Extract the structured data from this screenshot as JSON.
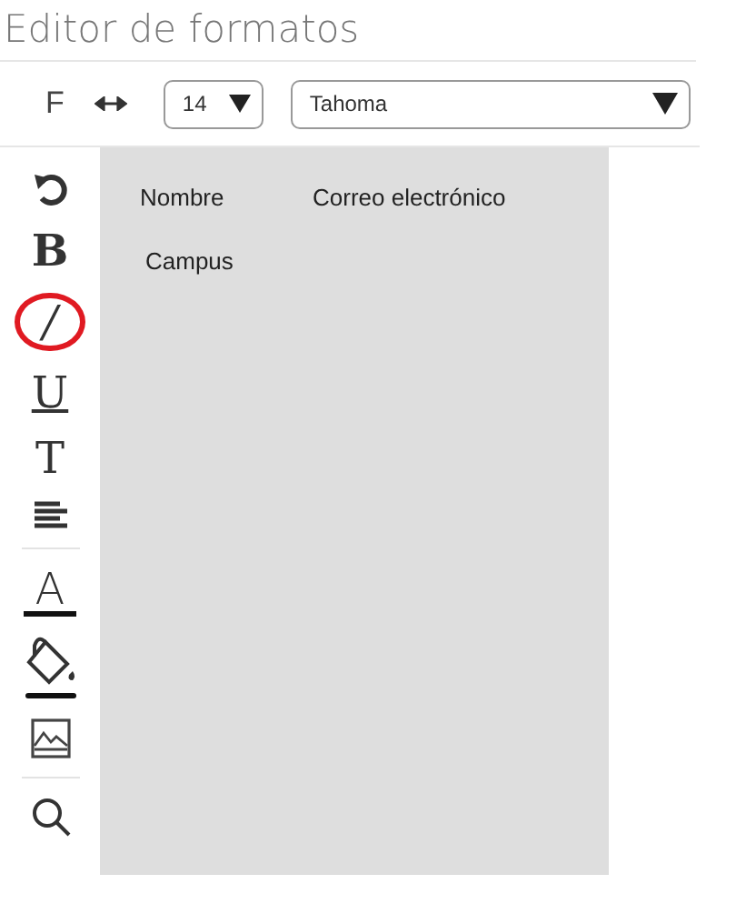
{
  "title": "Editor de formatos",
  "toolbar": {
    "font_label": "F",
    "size": "14",
    "font": "Tahoma"
  },
  "tools": [
    {
      "kind": "undo"
    },
    {
      "kind": "bold",
      "label": "B",
      "circled": false
    },
    {
      "kind": "italic",
      "label": "/",
      "circled": true
    },
    {
      "kind": "underline",
      "label": "U",
      "circled": false
    },
    {
      "kind": "text",
      "label": "T",
      "circled": false
    },
    {
      "kind": "align"
    },
    {
      "kind": "divider"
    },
    {
      "kind": "color",
      "label": "A",
      "circled": false
    },
    {
      "kind": "fill"
    },
    {
      "kind": "image"
    },
    {
      "kind": "divider"
    },
    {
      "kind": "search"
    }
  ],
  "canvas": {
    "fields": [
      {
        "label": "Nombre"
      },
      {
        "label": "Correo electrónico"
      },
      {
        "label": "Campus"
      }
    ]
  }
}
